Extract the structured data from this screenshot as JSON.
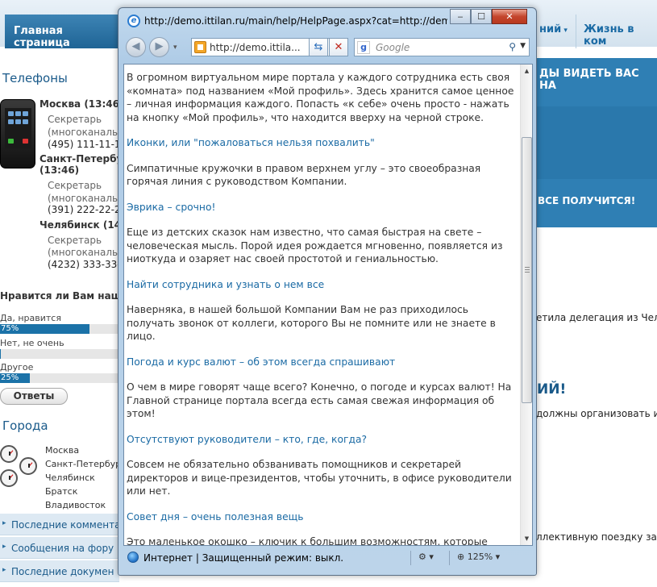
{
  "portal": {
    "nav": {
      "home": "Главная страница",
      "tab_partial": "ний",
      "tab_life": "Жизнь в ком"
    },
    "phones": {
      "title": "Телефоны",
      "contacts": [
        {
          "city": "Москва (13:46",
          "role_line1": "Секретарь",
          "role_line2": "(многоканальн",
          "phone": "(495) 111-11-1"
        },
        {
          "city": "Санкт-Петербур",
          "city_time": "(13:46)",
          "role_line1": "Секретарь",
          "role_line2": "(многоканальн",
          "phone": "(391) 222-22-2"
        },
        {
          "city": "Челябинск (14",
          "role_line1": "Секретарь",
          "role_line2": "(многоканальн",
          "phone": "(4232) 333-33-"
        }
      ]
    },
    "poll": {
      "question": "Нравится ли Вам наш п",
      "options": [
        {
          "label": "Да, нравится",
          "percent_text": "75%",
          "fraction": 0.75
        },
        {
          "label": "Нет, не очень",
          "percent_text": "",
          "fraction": 0.0
        },
        {
          "label": "Другое",
          "percent_text": "25%",
          "fraction": 0.25
        }
      ],
      "button": "Ответы"
    },
    "cities": {
      "title": "Города",
      "items": [
        "Москва",
        "Санкт-Петербург",
        "Челябинск",
        "Братск",
        "Владивосток"
      ]
    },
    "side_links": [
      "Последние коммента",
      "Сообщения на фору",
      "Последние докумен"
    ],
    "right": {
      "banner_top": "ДЫ ВИДЕТЬ ВАС НА",
      "banner_mid": "ВСЕ ПОЛУЧИТСЯ!",
      "news1": "етила делегация из Челябі",
      "heading": "ИЙ!",
      "news2": "должны организовать инс",
      "news3": "ллективную поездку за гор"
    }
  },
  "ie": {
    "title": "http://demo.ittilan.ru/main/help/HelpPage.aspx?cat=http://demo.ittil...",
    "address": "http://demo.ittila...",
    "search_placeholder": "Google",
    "status": "Интернет | Защищенный режим: выкл.",
    "zoom": "125%",
    "article": [
      {
        "kind": "body",
        "text": "В огромном виртуальном мире портала у каждого сотрудника есть своя «комната» под названием «Мой профиль». Здесь хранится самое ценное – личная информация каждого. Попасть «к себе» очень просто - нажать на кнопку «Мой профиль», что находится вверху на черной строке."
      },
      {
        "kind": "head",
        "text": "Иконки, или \"пожаловаться нельзя похвалить\""
      },
      {
        "kind": "body",
        "text": "Симпатичные кружочки в правом верхнем углу – это своеобразная горячая линия с руководством Компании."
      },
      {
        "kind": "head",
        "text": "Эврика – срочно!"
      },
      {
        "kind": "body",
        "text": "Еще из детских сказок нам известно, что самая быстрая на свете – человеческая мысль. Порой идея рождается мгновенно, появляется из ниоткуда и озаряет нас своей простотой и гениальностью."
      },
      {
        "kind": "head",
        "text": "Найти сотрудника и узнать о нем все"
      },
      {
        "kind": "body",
        "text": "Наверняка, в нашей большой Компании Вам не раз приходилось получать звонок от коллеги, которого Вы не помните или не знаете в лицо."
      },
      {
        "kind": "head",
        "text": "Погода и курс валют – об этом всегда спрашивают"
      },
      {
        "kind": "body",
        "text": "О чем в мире говорят чаще всего? Конечно, о погоде и курсах валют! На Главной странице портала всегда есть самая свежая информация об этом!"
      },
      {
        "kind": "head",
        "text": "Отсутствуют руководители – кто, где, когда?"
      },
      {
        "kind": "body",
        "text": "Совсем не обязательно обзванивать помощников и секретарей директоров и вице-президентов, чтобы уточнить, в офисе руководители или нет."
      },
      {
        "kind": "head",
        "text": "Совет дня – очень полезная вещь"
      },
      {
        "kind": "body",
        "text": "Это маленькое окошко – ключик к большим возможностям, которые предлагает наш портал."
      }
    ]
  }
}
